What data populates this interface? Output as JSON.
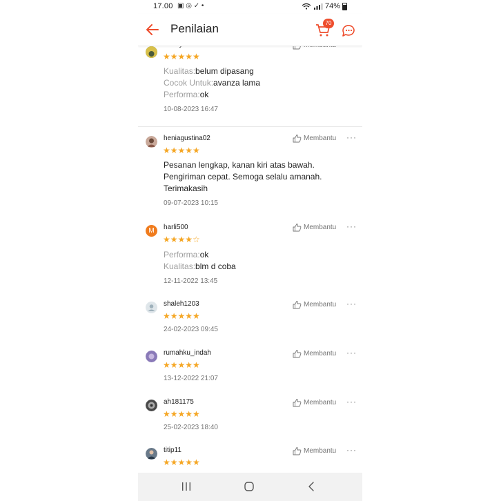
{
  "status_bar": {
    "time": "17.00",
    "notifications": "▣ ◎ ✓ •",
    "battery": "74%"
  },
  "header": {
    "title": "Penilaian",
    "cart_badge": "70"
  },
  "helpful_label": "Membantu",
  "more_label": "···",
  "reviews": [
    {
      "username": "rantoyunawan",
      "rating": 5,
      "stars": "★★★★★",
      "attributes": [
        {
          "key": "Kualitas:",
          "value": "belum dipasang"
        },
        {
          "key": "Cocok Untuk:",
          "value": "avanza lama"
        },
        {
          "key": "Performa:",
          "value": "ok"
        }
      ],
      "date": "10-08-2023 16:47"
    },
    {
      "username": "heniagustina02",
      "rating": 5,
      "stars": "★★★★★",
      "text": "Pesanan lengkap, kanan kiri atas bawah. Pengiriman cepat. Semoga selalu amanah. Terimakasih",
      "date": "09-07-2023 10:15"
    },
    {
      "username": "harli500",
      "avatar_letter": "M",
      "rating": 4,
      "stars": "★★★★☆",
      "attributes": [
        {
          "key": "Performa:",
          "value": "ok"
        },
        {
          "key": "Kualitas:",
          "value": "blm d coba"
        }
      ],
      "date": "12-11-2022 13:45"
    },
    {
      "username": "shaleh1203",
      "rating": 5,
      "stars": "★★★★★",
      "date": "24-02-2023 09:45"
    },
    {
      "username": "rumahku_indah",
      "rating": 5,
      "stars": "★★★★★",
      "date": "13-12-2022 21:07"
    },
    {
      "username": "ah181175",
      "rating": 5,
      "stars": "★★★★★",
      "date": "25-02-2023 18:40"
    },
    {
      "username": "titip11",
      "rating": 5,
      "stars": "★★★★★"
    }
  ],
  "icons": {
    "back": "arrow-left-icon",
    "cart": "cart-icon",
    "chat": "chat-icon",
    "helpful": "thumbs-up-icon",
    "nav_recent": "recent-apps-icon",
    "nav_home": "home-icon",
    "nav_back": "nav-back-icon"
  },
  "colors": {
    "accent": "#ee4d2d",
    "star": "#f5a623",
    "muted": "#9e9e9e"
  }
}
